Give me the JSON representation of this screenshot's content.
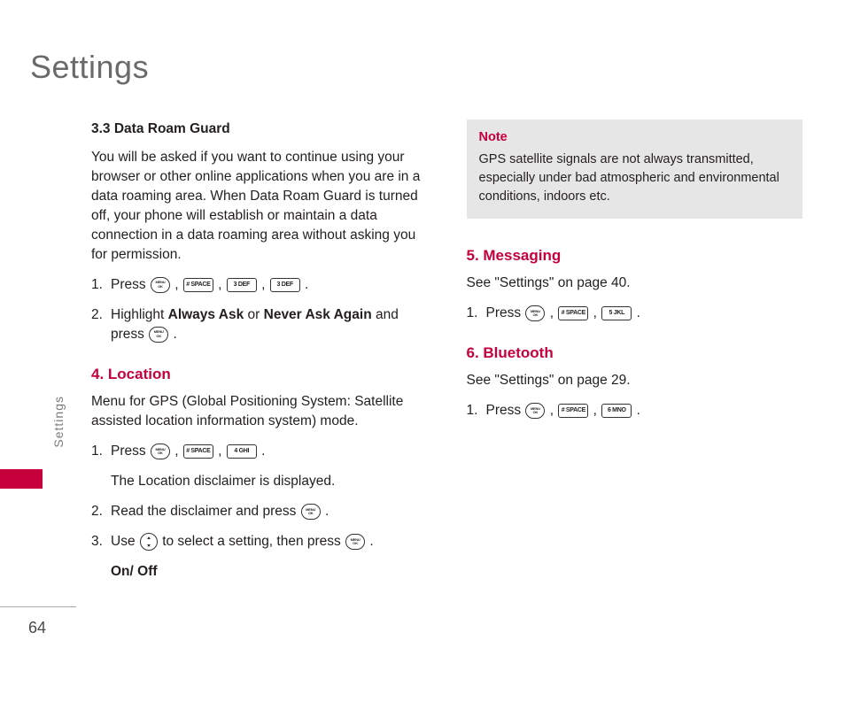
{
  "page_title": "Settings",
  "side_tab": "Settings",
  "page_number": "64",
  "left": {
    "sec33_head": "3.3 Data Roam Guard",
    "sec33_body": "You will be asked if you want to continue using your browser or other online applications when you are in a data roaming area. When Data Roam Guard is turned off, your phone will establish or maintain a data connection in a data roaming area without asking you for permission.",
    "s1_num": "1.",
    "s1_press": "Press ",
    "s2_num": "2.",
    "s2a": "Highlight ",
    "s2b": "Always Ask",
    "s2c": " or ",
    "s2d": "Never Ask Again",
    "s2e": " and press ",
    "sec4_head": "4. Location",
    "sec4_body": "Menu for GPS (Global Positioning System: Satellite assisted location information system) mode.",
    "l1_num": "1.",
    "l1_press": "Press ",
    "l1_after": "The Location disclaimer is displayed.",
    "l2_num": "2.",
    "l2_text": "Read the disclaimer and press ",
    "l3_num": "3.",
    "l3a": "Use ",
    "l3b": " to select a setting, then press ",
    "onoff": "On/ Off",
    "period": " .",
    "comma": " , ",
    "key_hash": "# SPACE",
    "key_3def": "3 DEF",
    "key_4ghi": "4 GHI"
  },
  "right": {
    "note_title": "Note",
    "note_body": "GPS satellite signals are not always transmitted, especially under bad atmospheric and environmental conditions, indoors etc.",
    "sec5_head": "5. Messaging",
    "sec5_body": "See \"Settings\" on page 40.",
    "m1_num": "1.",
    "m1_press": "Press ",
    "sec6_head": "6. Bluetooth",
    "sec6_body": "See \"Settings\" on page 29.",
    "b1_num": "1.",
    "b1_press": "Press ",
    "key_hash": "# SPACE",
    "key_5jkl": "5 JKL",
    "key_6mno": "6 MNO",
    "period": " .",
    "comma": " , "
  }
}
